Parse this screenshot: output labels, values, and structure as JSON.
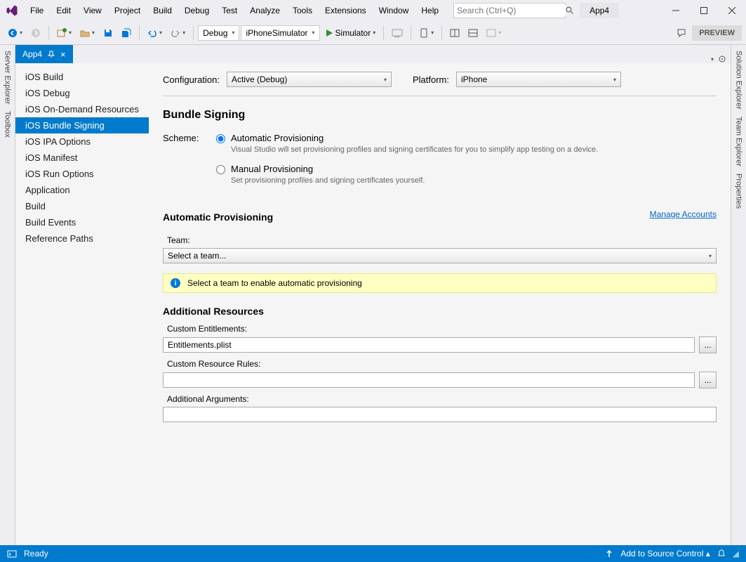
{
  "menu": {
    "items": [
      "File",
      "Edit",
      "View",
      "Project",
      "Build",
      "Debug",
      "Test",
      "Analyze",
      "Tools",
      "Extensions",
      "Window",
      "Help"
    ]
  },
  "search": {
    "placeholder": "Search (Ctrl+Q)"
  },
  "title": {
    "app": "App4"
  },
  "toolbar": {
    "config": "Debug",
    "target": "iPhoneSimulator",
    "run": "Simulator",
    "preview": "PREVIEW"
  },
  "leftTools": {
    "a": "Server Explorer",
    "b": "Toolbox"
  },
  "rightTools": {
    "a": "Solution Explorer",
    "b": "Team Explorer",
    "c": "Properties"
  },
  "tab": {
    "name": "App4"
  },
  "sidebar": {
    "items": [
      "iOS Build",
      "iOS Debug",
      "iOS On-Demand Resources",
      "iOS Bundle Signing",
      "iOS IPA Options",
      "iOS Manifest",
      "iOS Run Options",
      "Application",
      "Build",
      "Build Events",
      "Reference Paths"
    ],
    "selectedIndex": 3
  },
  "cfg": {
    "configuration_label": "Configuration:",
    "configuration_value": "Active (Debug)",
    "platform_label": "Platform:",
    "platform_value": "iPhone"
  },
  "main": {
    "title": "Bundle Signing",
    "scheme_label": "Scheme:",
    "auto_title": "Automatic Provisioning",
    "auto_desc": "Visual Studio will set provisioning profiles and signing certificates for you to simplify app testing on a device.",
    "manual_title": "Manual Provisioning",
    "manual_desc": "Set provisioning profiles and signing certificates yourself.",
    "ap_heading": "Automatic Provisioning",
    "manage_link": "Manage Accounts",
    "team_label": "Team:",
    "team_value": "Select a team...",
    "info_text": "Select a team to enable automatic provisioning",
    "ar_heading": "Additional Resources",
    "ce_label": "Custom Entitlements:",
    "ce_value": "Entitlements.plist",
    "crr_label": "Custom Resource Rules:",
    "crr_value": "",
    "aa_label": "Additional Arguments:",
    "aa_value": "",
    "browse": "..."
  },
  "status": {
    "ready": "Ready",
    "source": "Add to Source Control"
  }
}
